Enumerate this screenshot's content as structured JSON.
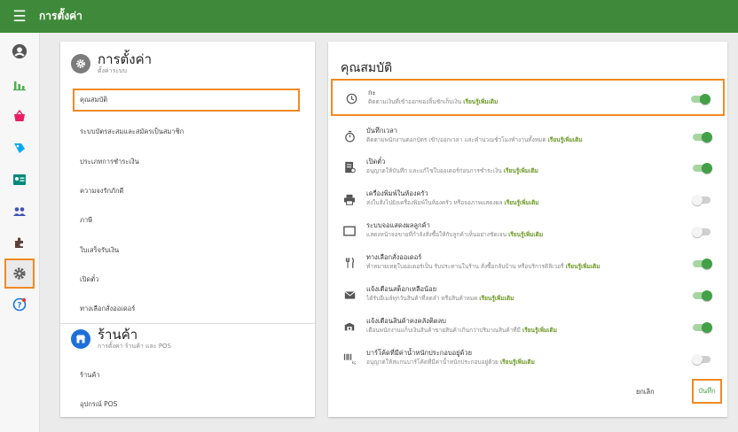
{
  "topbar": {
    "title": "การตั้งค่า"
  },
  "left": {
    "settings_section": {
      "title": "การตั้งค่า",
      "subtitle": "ตั้งค่าระบบ"
    },
    "menu": [
      {
        "label": "คุณสมบัติ",
        "active": true
      },
      {
        "label": "ระบบบัตรสะสมและสมัครเป็นสมาชิก"
      },
      {
        "label": "ประเภทการชำระเงิน"
      },
      {
        "label": "ความจงรักภักดี"
      },
      {
        "label": "ภาษี"
      },
      {
        "label": "ใบเสร็จรับเงิน"
      },
      {
        "label": "เปิดตั๋ว"
      },
      {
        "label": "ทางเลือกสั่งออเดอร์"
      }
    ],
    "store_section": {
      "title": "ร้านค้า",
      "subtitle": "การตั้งค่า ร้านค้า และ POS"
    },
    "store_menu": [
      {
        "label": "ร้านค้า"
      },
      {
        "label": "อุปกรณ์ POS"
      }
    ]
  },
  "right": {
    "title": "คุณสมบัติ",
    "learn_more": "เรียนรู้เพิ่มเติม",
    "features": [
      {
        "icon": "clock-icon",
        "title": "กะ",
        "desc": "ติดตามเงินที่เข้าออกของลิ้นชักเก็บเงิน",
        "on": true,
        "active": true
      },
      {
        "icon": "stopwatch-icon",
        "title": "บันทึกเวลา",
        "desc": "ติดตามพนักงานตอกบัตร เข้า/ออกเวลา และคำนวณชั่วโมงทำงานทั้งหมด",
        "on": true
      },
      {
        "icon": "ticket-icon",
        "title": "เปิดตั๋ว",
        "desc": "อนุญาตให้บันทึก และแก้ไขใบออเดอร์ก่อนการชำระเงิน",
        "on": true
      },
      {
        "icon": "printer-icon",
        "title": "เครื่องพิมพ์ในห้องครัว",
        "desc": "ส่งใบสั่งไปยังเครื่องพิมพ์ในห้องครัว หรือจอภาพแสดงผล",
        "on": false
      },
      {
        "icon": "display-icon",
        "title": "ระบบจอแสดงผลลูกค้า",
        "desc": "แสดงหน้าจอขายที่กำลังสั่งซื้อให้กับลูกค้าเห็นอย่างชัดเจน",
        "on": false
      },
      {
        "icon": "cutlery-icon",
        "title": "ทางเลือกสั่งออเดอร์",
        "desc": "ทำหมายเหตุใบออเดอร์เป็น รับประทานในร้าน สั่งซื้อกลับบ้าน หรือบริการดิลิเวอรี่",
        "on": true
      },
      {
        "icon": "mail-icon",
        "title": "แจ้งเตือนสต็อกเหลือน้อย",
        "desc": "ได้รับอีเมล์ทุกวันสินค้าที่ลดลำ หรือสินค้าหมด",
        "on": true
      },
      {
        "icon": "box-icon",
        "title": "แจ้งเตือนสินค้าคงคลังติดลบ",
        "desc": "เตือนพนักงานแก็บเงินสินค้าขายสินค้าเกินกว่าปริมาณสินค้าที่มี",
        "on": true
      },
      {
        "icon": "barcode-scale-icon",
        "title": "บาร์โค้ดที่มีค่าน้ำหนักประกอบอยู่ด้วย",
        "desc": "อนุญาตให้สแกนบาร์โค้ดที่มีค่าน้ำหนักประกอบอยู่ด้วย",
        "on": false
      }
    ],
    "cancel_label": "ยกเลิก",
    "save_label": "บันทึก"
  },
  "colors": {
    "primary": "#3f8a3a",
    "highlight": "#f08a24",
    "toggle_on": "#43a047"
  }
}
